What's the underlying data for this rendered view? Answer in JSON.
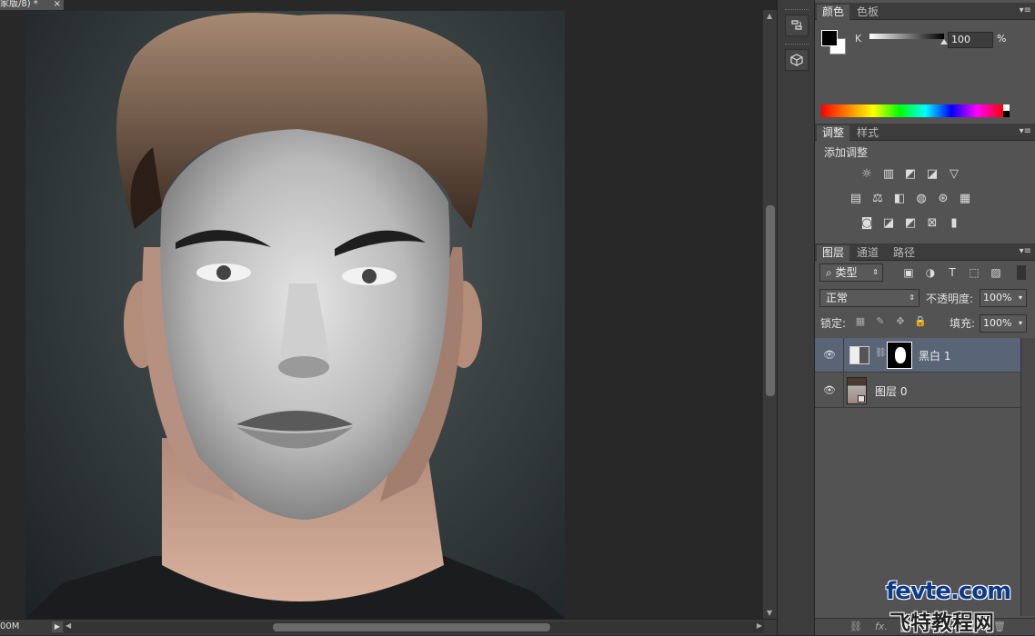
{
  "document": {
    "tab_title": "家版/8) *",
    "tab_close": "×",
    "zoom": "00M"
  },
  "color_panel": {
    "tabs": [
      "颜色",
      "色板"
    ],
    "channel_label": "K",
    "channel_value": "100",
    "unit": "%",
    "fg_color": "#000000",
    "bg_color": "#ffffff",
    "k_percent": 100
  },
  "adjustments_panel": {
    "tabs": [
      "调整",
      "样式"
    ],
    "title": "添加调整",
    "icons": [
      "brightness-icon",
      "levels-icon",
      "curves-icon",
      "exposure-icon",
      "vibrance-icon",
      "hue-saturation-icon",
      "color-balance-icon",
      "black-white-icon",
      "photo-filter-icon",
      "channel-mixer-icon",
      "color-lookup-icon",
      "invert-icon",
      "posterize-icon",
      "threshold-icon",
      "selective-color-icon",
      "gradient-map-icon"
    ]
  },
  "layers_panel": {
    "tabs": [
      "图层",
      "通道",
      "路径"
    ],
    "filter_label": "类型",
    "blend_mode": "正常",
    "opacity_label": "不透明度:",
    "opacity_value": "100%",
    "lock_label": "锁定:",
    "fill_label": "填充:",
    "fill_value": "100%",
    "layers": [
      {
        "name": "黑白 1",
        "selected": true,
        "visible": true,
        "type": "adjustment"
      },
      {
        "name": "图层 0",
        "selected": false,
        "visible": true,
        "type": "pixel"
      }
    ],
    "footer_icons": [
      "link-icon",
      "fx-icon",
      "mask-icon",
      "adjustment-new-icon",
      "group-icon",
      "new-layer-icon",
      "trash-icon"
    ],
    "footer_fx": "fx."
  },
  "watermark": {
    "line1": "fevte.com",
    "line2": "飞特教程网"
  },
  "colors": {
    "panel_bg": "#535353",
    "panel_header": "#3c3c3c",
    "selected_layer": "#5a6477",
    "workspace": "#282828"
  }
}
